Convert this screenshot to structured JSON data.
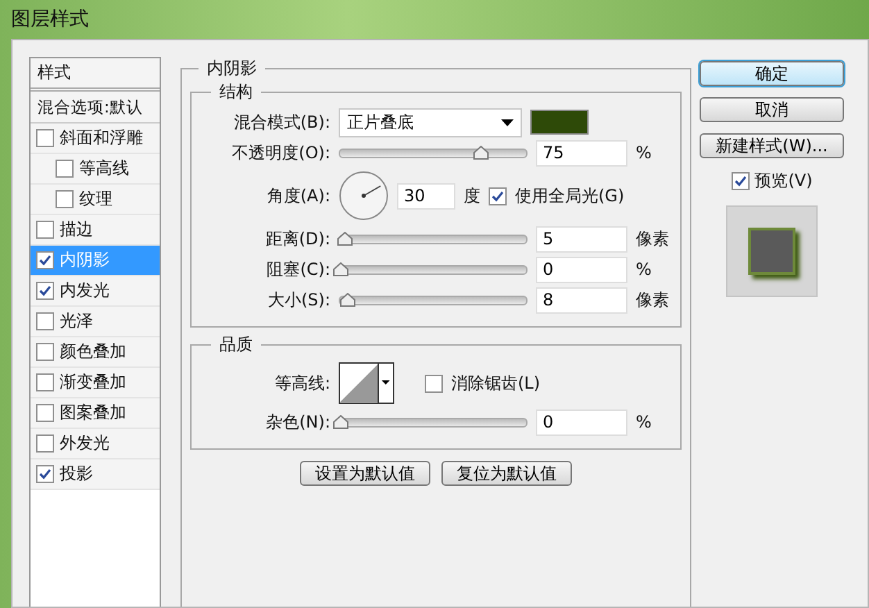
{
  "window": {
    "title": "图层样式"
  },
  "styles_panel": {
    "header": "样式",
    "blend_options": "混合选项:默认",
    "items": [
      {
        "label": "斜面和浮雕",
        "checked": false,
        "selected": false,
        "children": [
          {
            "label": "等高线",
            "checked": false,
            "selected": false
          },
          {
            "label": "纹理",
            "checked": false,
            "selected": false
          }
        ]
      },
      {
        "label": "描边",
        "checked": false,
        "selected": false
      },
      {
        "label": "内阴影",
        "checked": true,
        "selected": true
      },
      {
        "label": "内发光",
        "checked": true,
        "selected": false
      },
      {
        "label": "光泽",
        "checked": false,
        "selected": false
      },
      {
        "label": "颜色叠加",
        "checked": false,
        "selected": false
      },
      {
        "label": "渐变叠加",
        "checked": false,
        "selected": false
      },
      {
        "label": "图案叠加",
        "checked": false,
        "selected": false
      },
      {
        "label": "外发光",
        "checked": false,
        "selected": false
      },
      {
        "label": "投影",
        "checked": true,
        "selected": false
      }
    ]
  },
  "inner_shadow": {
    "title": "内阴影",
    "structure": {
      "title": "结构",
      "blend_mode": {
        "label": "混合模式(B):",
        "value": "正片叠底",
        "color": "#2e4a08"
      },
      "opacity": {
        "label": "不透明度(O):",
        "value": "75",
        "unit": "%",
        "level": 0.75
      },
      "angle": {
        "label": "角度(A):",
        "value": "30",
        "unit": "度",
        "global_light": {
          "label": "使用全局光(G)",
          "checked": true
        }
      },
      "distance": {
        "label": "距离(D):",
        "value": "5",
        "unit": "像素",
        "level": 0.02
      },
      "choke": {
        "label": "阻塞(C):",
        "value": "0",
        "unit": "%",
        "level": 0
      },
      "size": {
        "label": "大小(S):",
        "value": "8",
        "unit": "像素",
        "level": 0.04
      }
    },
    "quality": {
      "title": "品质",
      "contour": {
        "label": "等高线:"
      },
      "anti_alias": {
        "label": "消除锯齿(L)",
        "checked": false
      },
      "noise": {
        "label": "杂色(N):",
        "value": "0",
        "unit": "%",
        "level": 0
      }
    },
    "buttons": [
      "设置为默认值",
      "复位为默认值"
    ]
  },
  "actions": [
    {
      "label": "确定",
      "kind": "primary"
    },
    {
      "label": "取消",
      "kind": "normal"
    },
    {
      "label": "新建样式(W)...",
      "kind": "normal"
    }
  ],
  "preview": {
    "label": "预览(V)",
    "checked": true
  }
}
